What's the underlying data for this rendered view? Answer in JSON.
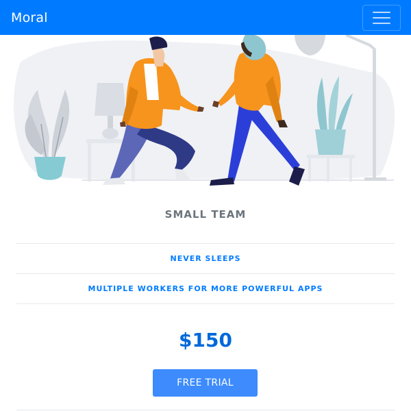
{
  "navbar": {
    "brand": "Moral",
    "menu_icon": "hamburger-menu-icon",
    "background": "#007bff"
  },
  "hero": {
    "illustration": "two-people-reaching-hands-illustration"
  },
  "plan": {
    "title": "SMALL TEAM",
    "features": [
      "NEVER SLEEPS",
      "MULTIPLE WORKERS FOR MORE POWERFUL APPS"
    ],
    "price": "$150",
    "cta_label": "FREE TRIAL"
  },
  "colors": {
    "accent": "#007bff",
    "title_gray": "#6c757d",
    "button": "#3d8bfd"
  }
}
